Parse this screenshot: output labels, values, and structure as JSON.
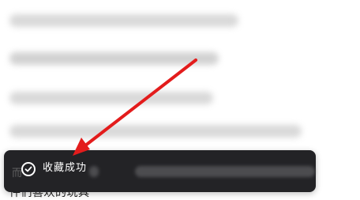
{
  "background": {
    "visible_text": "件们喜欢的玩具"
  },
  "toast": {
    "label": "收藏成功",
    "background_text": "而"
  },
  "annotation": {
    "arrow_color": "#e31c1c"
  }
}
